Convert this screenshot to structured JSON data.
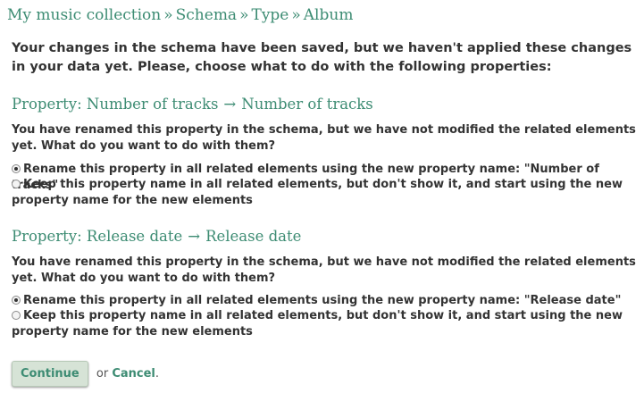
{
  "breadcrumb": {
    "items": [
      "My music collection",
      "Schema",
      "Type",
      "Album"
    ],
    "separator": "»"
  },
  "intro": "Your changes in the schema have been saved, but we haven't applied these changes in your data yet. Please, choose what to do with the following properties:",
  "properties": [
    {
      "heading_prefix": "Property: Number of tracks",
      "arrow": "→",
      "new_name": "Number of tracks",
      "description": "You have renamed this property in the schema, but we have not modified the related elements yet. What do you want to do with them?",
      "options": [
        {
          "label": "Rename this property in all related elements using the new property name: \"Number of tracks\"",
          "checked": true
        },
        {
          "label": "Keep this property name in all related elements, but don't show it, and start using the new property name for the new elements",
          "checked": false
        }
      ]
    },
    {
      "heading_prefix": "Property: Release date",
      "arrow": "→",
      "new_name": "Release date",
      "description": "You have renamed this property in the schema, but we have not modified the related elements yet. What do you want to do with them?",
      "options": [
        {
          "label": "Rename this property in all related elements using the new property name: \"Release date\"",
          "checked": true
        },
        {
          "label": "Keep this property name in all related elements, but don't show it, and start using the new property name for the new elements",
          "checked": false
        }
      ]
    }
  ],
  "actions": {
    "continue_label": "Continue",
    "or_text": "or",
    "cancel_label": "Cancel",
    "period": "."
  },
  "colors": {
    "accent": "#3d8c73",
    "text": "#333333",
    "button_bg": "#d6e3d6"
  }
}
